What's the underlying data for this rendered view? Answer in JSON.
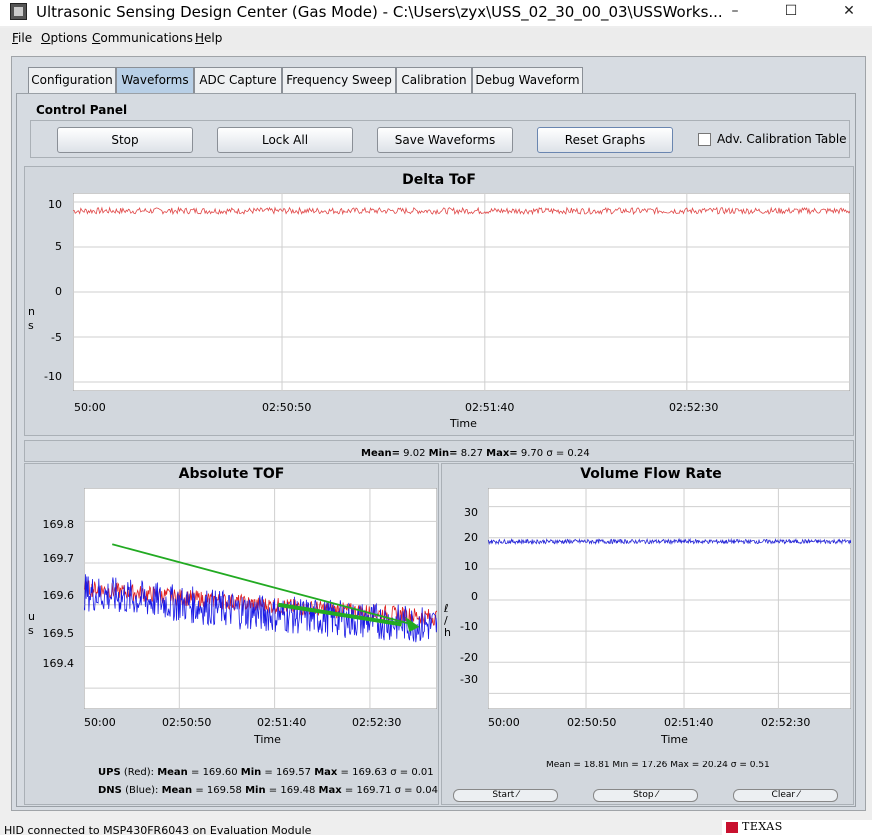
{
  "window": {
    "title": "Ultrasonic Sensing Design Center (Gas Mode) - C:\\Users\\zyx\\USS_02_30_00_03\\USSWorks...",
    "minimize": "–",
    "maximize": "☐",
    "close": "✕"
  },
  "menu": [
    "File",
    "Options",
    "Communications",
    "Help"
  ],
  "tabs": [
    "Configuration",
    "Waveforms",
    "ADC Capture",
    "Frequency Sweep",
    "Calibration",
    "Debug Waveform"
  ],
  "active_tab": "Waveforms",
  "control_panel": {
    "title": "Control Panel",
    "buttons": [
      "Stop",
      "Lock All",
      "Save Waveforms",
      "Reset Graphs"
    ],
    "checkbox_label": "Adv. Calibration Table",
    "checkbox_checked": false
  },
  "delta_tof": {
    "title": "Delta ToF",
    "ylabel": "n\ns",
    "xlabel": "Time",
    "yticks": [
      "10",
      "5",
      "0",
      "-5",
      "-10"
    ],
    "xticks": [
      "50:00",
      "02:50:50",
      "02:51:40",
      "02:52:30"
    ],
    "stats": {
      "mean_label": "Mean=",
      "mean": "9.02",
      "min_label": "Min=",
      "min": "8.27",
      "max_label": "Max=",
      "max": "9.70",
      "sigma_label": "σ =",
      "sigma": "0.24"
    }
  },
  "absolute_tof": {
    "title": "Absolute TOF",
    "ylabel": "u\ns",
    "xlabel": "Time",
    "yticks": [
      "169.8",
      "169.7",
      "169.6",
      "169.5",
      "169.4"
    ],
    "xticks": [
      "50:00",
      "02:50:50",
      "02:51:40",
      "02:52:30"
    ],
    "ups": {
      "label": "UPS",
      "color_label": "(Red):",
      "mean_label": "Mean",
      "mean": "169.60",
      "min_label": "Min",
      "min": "169.57",
      "max_label": "Max",
      "max": "169.63",
      "sigma_label": "σ",
      "sigma": "0.01"
    },
    "dns": {
      "label": "DNS",
      "color_label": "(Blue):",
      "mean_label": "Mean",
      "mean": "169.58",
      "min_label": "Min",
      "min": "169.48",
      "max_label": "Max",
      "max": "169.71",
      "sigma_label": "σ",
      "sigma": "0.04"
    }
  },
  "volume_flow": {
    "title": "Volume Flow Rate",
    "ylabel": "ℓ\n/\nh",
    "xlabel": "Time",
    "yticks": [
      "30",
      "20",
      "10",
      "0",
      "-10",
      "-20",
      "-30"
    ],
    "xticks": [
      "50:00",
      "02:50:50",
      "02:51:40",
      "02:52:30"
    ],
    "stats": "Mean = 18.81 Min = 17.26 Max = 20.24 σ = 0.51",
    "buttons": [
      "Start",
      "Stop",
      "Clear"
    ]
  },
  "status": {
    "text": "HID connected to MSP430FR6043 on Evaluation Module",
    "logo": "TEXAS INSTRUMENTS"
  },
  "colors": {
    "ups": "#e02020",
    "dns": "#1a1ae6",
    "delta": "#e04848",
    "flow": "#2a2ad8",
    "annotation_arrow": "#22aa22",
    "active_tab": "#b8cfe6"
  },
  "chart_data": [
    {
      "type": "line",
      "title": "Delta ToF",
      "xlabel": "Time",
      "ylabel": "ns",
      "ylim": [
        -11,
        11
      ],
      "x_ticks": [
        "50:00",
        "02:50:50",
        "02:51:40",
        "02:52:30"
      ],
      "series": [
        {
          "values": [
            9.02
          ]
        }
      ]
    },
    {
      "type": "line",
      "title": "Absolute TOF",
      "xlabel": "Time",
      "ylabel": "us",
      "ylim": [
        169.35,
        169.88
      ],
      "x_ticks": [
        "50:00",
        "02:50:50",
        "02:51:40",
        "02:52:30"
      ],
      "series": [
        {
          "name": "UPS",
          "values": [
            169.64,
            169.6,
            169.57
          ]
        },
        {
          "name": "DNS",
          "values": [
            169.63,
            169.58,
            169.55
          ]
        }
      ]
    },
    {
      "type": "line",
      "title": "Volume Flow Rate",
      "xlabel": "Time",
      "ylabel": "l/h",
      "ylim": [
        -35,
        36
      ],
      "x_ticks": [
        "50:00",
        "02:50:50",
        "02:51:40",
        "02:52:30"
      ],
      "series": [
        {
          "values": [
            18.81
          ]
        }
      ]
    }
  ]
}
